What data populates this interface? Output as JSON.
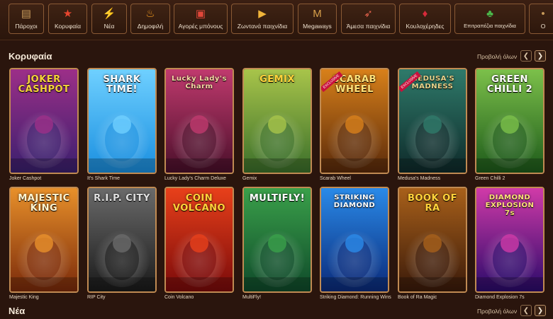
{
  "categories": [
    {
      "label": "Πάροχοι",
      "icon": "provider-icon",
      "color": "#c79a5a"
    },
    {
      "label": "Κορυφαία",
      "icon": "star-icon",
      "color": "#e8462f"
    },
    {
      "label": "Νέα",
      "icon": "lightning-icon",
      "color": "#f2c23a"
    },
    {
      "label": "Δημοφιλή",
      "icon": "flame-icon",
      "color": "#f29a1f"
    },
    {
      "label": "Αγορές μπόνους",
      "icon": "gift-icon",
      "color": "#e0473a"
    },
    {
      "label": "Ζωντανά παιχνίδια",
      "icon": "play-icon",
      "color": "#f0b43a"
    },
    {
      "label": "Megaways",
      "icon": "megaways-icon",
      "color": "#d8a04a"
    },
    {
      "label": "Άμεσα παιχνίδια",
      "icon": "rocket-icon",
      "color": "#e0604a"
    },
    {
      "label": "Κουλοχέρηδες",
      "icon": "cherry-icon",
      "color": "#d62a3a"
    },
    {
      "label": "Επιτραπέζια παιχνίδια",
      "icon": "clover-icon",
      "color": "#4bb84a"
    },
    {
      "label": "O",
      "icon": "more-icon",
      "color": "#c79a5a"
    }
  ],
  "sections": {
    "top": {
      "title": "Κορυφαία",
      "view_all": "Προβολή όλων"
    },
    "new": {
      "title": "Νέα",
      "view_all": "Προβολή όλων"
    }
  },
  "games_row1": [
    {
      "name": "Joker Cashpot",
      "art": "JOKER CASHPOT",
      "bg1": "#3a1f6e",
      "bg2": "#9c2f88",
      "ink": "#f6d23a"
    },
    {
      "name": "It's Shark Time",
      "art": "SHARK TIME!",
      "bg1": "#1a8fe0",
      "bg2": "#6fd0ff",
      "ink": "#ffffff"
    },
    {
      "name": "Lucky Lady's Charm Deluxe",
      "art": "Lucky Lady's Charm",
      "bg1": "#4a0f2a",
      "bg2": "#c03a6e",
      "ink": "#f7d9a4"
    },
    {
      "name": "Gemix",
      "art": "GEMIX",
      "bg1": "#3b6f2a",
      "bg2": "#a8c44a",
      "ink": "#ffd23a"
    },
    {
      "name": "Scarab Wheel",
      "art": "SCARAB WHEEL",
      "bg1": "#5a2a0a",
      "bg2": "#d8801a",
      "ink": "#ffe27a",
      "badge": "EXCLUSIVE"
    },
    {
      "name": "Medusa's Madness",
      "art": "MEDUSA'S MADNESS",
      "bg1": "#0e2a2a",
      "bg2": "#2f7a6a",
      "ink": "#e8d28a",
      "badge": "EXCLUSIVE"
    },
    {
      "name": "Green Chilli 2",
      "art": "GREEN CHILLI 2",
      "bg1": "#1d5a1a",
      "bg2": "#7cc04a",
      "ink": "#ffffff"
    }
  ],
  "games_row2": [
    {
      "name": "Majestic King",
      "art": "MAJESTIC KING",
      "bg1": "#7a2a0a",
      "bg2": "#e8902a",
      "ink": "#fff4d0"
    },
    {
      "name": "RIP City",
      "art": "R.I.P. CITY",
      "bg1": "#1a1a1a",
      "bg2": "#6a6a6a",
      "ink": "#e0e0e0"
    },
    {
      "name": "Coin Volcano",
      "art": "COIN VOLCANO",
      "bg1": "#7a0a0a",
      "bg2": "#e8401a",
      "ink": "#ffd23a"
    },
    {
      "name": "MultiFly!",
      "art": "MULTIFLY!",
      "bg1": "#0f4a2a",
      "bg2": "#3aa04a",
      "ink": "#ffffff"
    },
    {
      "name": "Striking Diamond: Running Wins",
      "art": "STRIKING DIAMOND",
      "bg1": "#0a2a7a",
      "bg2": "#2a8ae8",
      "ink": "#ffffff"
    },
    {
      "name": "Book of Ra Magic",
      "art": "BOOK OF RA",
      "bg1": "#3a1a0a",
      "bg2": "#a8601a",
      "ink": "#ffd23a"
    },
    {
      "name": "Diamond Explosion 7s",
      "art": "DIAMOND EXPLOSION 7s",
      "bg1": "#2a0a6a",
      "bg2": "#d03aa8",
      "ink": "#ffe27a"
    }
  ]
}
